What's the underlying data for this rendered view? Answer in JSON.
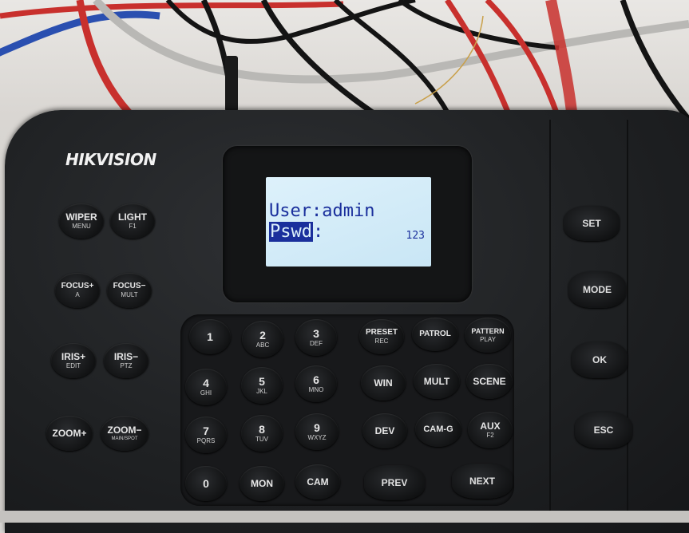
{
  "brand": "HIKVISION",
  "lcd": {
    "line1": "User:admin",
    "pswd_label": "Pswd",
    "pswd_colon": ":",
    "value": "123"
  },
  "left_buttons": [
    {
      "main": "WIPER",
      "sub": "MENU"
    },
    {
      "main": "LIGHT",
      "sub": "F1"
    },
    {
      "main": "FOCUS+",
      "sub": "A"
    },
    {
      "main": "FOCUS−",
      "sub": "MULT"
    },
    {
      "main": "IRIS+",
      "sub": "EDIT"
    },
    {
      "main": "IRIS−",
      "sub": "PTZ"
    },
    {
      "main": "ZOOM+",
      "sub": ""
    },
    {
      "main": "ZOOM−",
      "sub": "MAIN/SPOT"
    }
  ],
  "keypad": [
    {
      "main": "1",
      "sub": ""
    },
    {
      "main": "2",
      "sub": "ABC"
    },
    {
      "main": "3",
      "sub": "DEF"
    },
    {
      "main": "4",
      "sub": "GHI"
    },
    {
      "main": "5",
      "sub": "JKL"
    },
    {
      "main": "6",
      "sub": "MNO"
    },
    {
      "main": "7",
      "sub": "PQRS"
    },
    {
      "main": "8",
      "sub": "TUV"
    },
    {
      "main": "9",
      "sub": "WXYZ"
    },
    {
      "main": "0",
      "sub": ""
    },
    {
      "main": "MON",
      "sub": ""
    },
    {
      "main": "CAM",
      "sub": ""
    }
  ],
  "function_keys": [
    {
      "main": "PRESET",
      "sub": "REC"
    },
    {
      "main": "PATROL",
      "sub": ""
    },
    {
      "main": "PATTERN",
      "sub": "PLAY"
    },
    {
      "main": "WIN",
      "sub": ""
    },
    {
      "main": "MULT",
      "sub": ""
    },
    {
      "main": "SCENE",
      "sub": ""
    },
    {
      "main": "DEV",
      "sub": ""
    },
    {
      "main": "CAM-G",
      "sub": ""
    },
    {
      "main": "AUX",
      "sub": "F2"
    },
    {
      "main": "PREV",
      "sub": ""
    },
    {
      "main": "NEXT",
      "sub": ""
    }
  ],
  "right_buttons": [
    "SET",
    "MODE",
    "OK",
    "ESC"
  ]
}
